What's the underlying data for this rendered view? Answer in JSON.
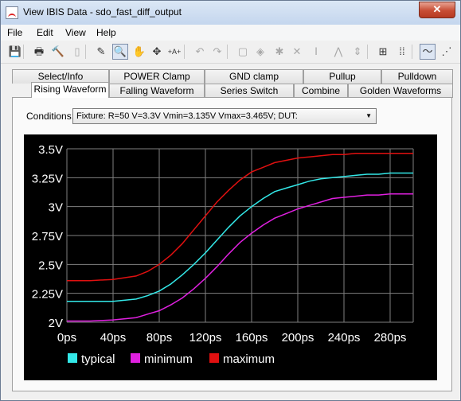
{
  "window": {
    "title": "View IBIS Data - sdo_fast_diff_output",
    "close_glyph": "✕"
  },
  "menu": [
    "File",
    "Edit",
    "View",
    "Help"
  ],
  "toolbar": {
    "icons": [
      "save-icon",
      "print-icon",
      "hammer-icon",
      "document-icon",
      "pencil-icon",
      "zoom-box-icon",
      "hand-icon",
      "move-icon",
      "add-point-icon",
      "undo-icon",
      "redo-icon",
      "select-box-icon",
      "diamond-icon",
      "star-icon",
      "cross-icon",
      "vertical-cursor-icon",
      "caret-icon",
      "vertical-arrows-icon",
      "fit-view-icon",
      "grid-points-icon",
      "curve-icon",
      "scatter-icon"
    ],
    "glyphs": [
      "💾",
      "🖶",
      "🔨",
      "▯",
      "✎",
      "🔍",
      "✋",
      "✥",
      "+A+",
      "↶",
      "↷",
      "▢",
      "◈",
      "✱",
      "✕",
      "Ⅰ",
      "⋀",
      "⇕",
      "⊞",
      "⁞⁞",
      "〜",
      "⋰"
    ]
  },
  "tabs_back": [
    "Select/Info",
    "POWER Clamp",
    "GND clamp",
    "Pullup",
    "Pulldown"
  ],
  "tabs_front": [
    "Rising Waveform",
    "Falling Waveform",
    "Series Switch",
    "Combine",
    "Golden Waveforms"
  ],
  "active_tab": "Rising Waveform",
  "conditions": {
    "label": "Conditions:",
    "value": "Fixture: R=50 V=3.3V Vmin=3.135V Vmax=3.465V;  DUT:"
  },
  "colors": {
    "background": "#000000",
    "grid": "#808080",
    "typical": "#33e8e8",
    "minimum": "#e020e0",
    "maximum": "#e01010",
    "text": "#ffffff"
  },
  "chart_data": {
    "type": "line",
    "title": "",
    "xlabel": "",
    "ylabel": "",
    "x_ticks": [
      "0ps",
      "40ps",
      "80ps",
      "120ps",
      "160ps",
      "200ps",
      "240ps",
      "280ps"
    ],
    "y_ticks": [
      "2V",
      "2.25V",
      "2.5V",
      "2.75V",
      "3V",
      "3.25V",
      "3.5V"
    ],
    "xlim": [
      0,
      300
    ],
    "ylim": [
      2.0,
      3.5
    ],
    "grid": true,
    "legend": "bottom-left",
    "x": [
      0,
      20,
      40,
      60,
      70,
      80,
      90,
      100,
      110,
      120,
      130,
      140,
      150,
      160,
      170,
      180,
      190,
      200,
      210,
      220,
      230,
      240,
      250,
      260,
      270,
      280,
      290,
      300
    ],
    "series": [
      {
        "name": "typical",
        "color": "#33e8e8",
        "values": [
          2.18,
          2.18,
          2.18,
          2.2,
          2.23,
          2.27,
          2.33,
          2.41,
          2.5,
          2.6,
          2.71,
          2.82,
          2.92,
          3.0,
          3.07,
          3.13,
          3.16,
          3.19,
          3.22,
          3.24,
          3.25,
          3.26,
          3.27,
          3.28,
          3.28,
          3.29,
          3.29,
          3.29
        ]
      },
      {
        "name": "minimum",
        "color": "#e020e0",
        "values": [
          2.01,
          2.01,
          2.02,
          2.04,
          2.07,
          2.1,
          2.15,
          2.21,
          2.29,
          2.38,
          2.48,
          2.59,
          2.69,
          2.77,
          2.84,
          2.9,
          2.94,
          2.98,
          3.01,
          3.04,
          3.07,
          3.08,
          3.09,
          3.1,
          3.1,
          3.11,
          3.11,
          3.11
        ]
      },
      {
        "name": "maximum",
        "color": "#e01010",
        "values": [
          2.36,
          2.36,
          2.37,
          2.4,
          2.44,
          2.5,
          2.58,
          2.68,
          2.8,
          2.92,
          3.04,
          3.14,
          3.23,
          3.3,
          3.34,
          3.38,
          3.4,
          3.42,
          3.43,
          3.44,
          3.45,
          3.45,
          3.46,
          3.46,
          3.46,
          3.46,
          3.46,
          3.46
        ]
      }
    ]
  }
}
